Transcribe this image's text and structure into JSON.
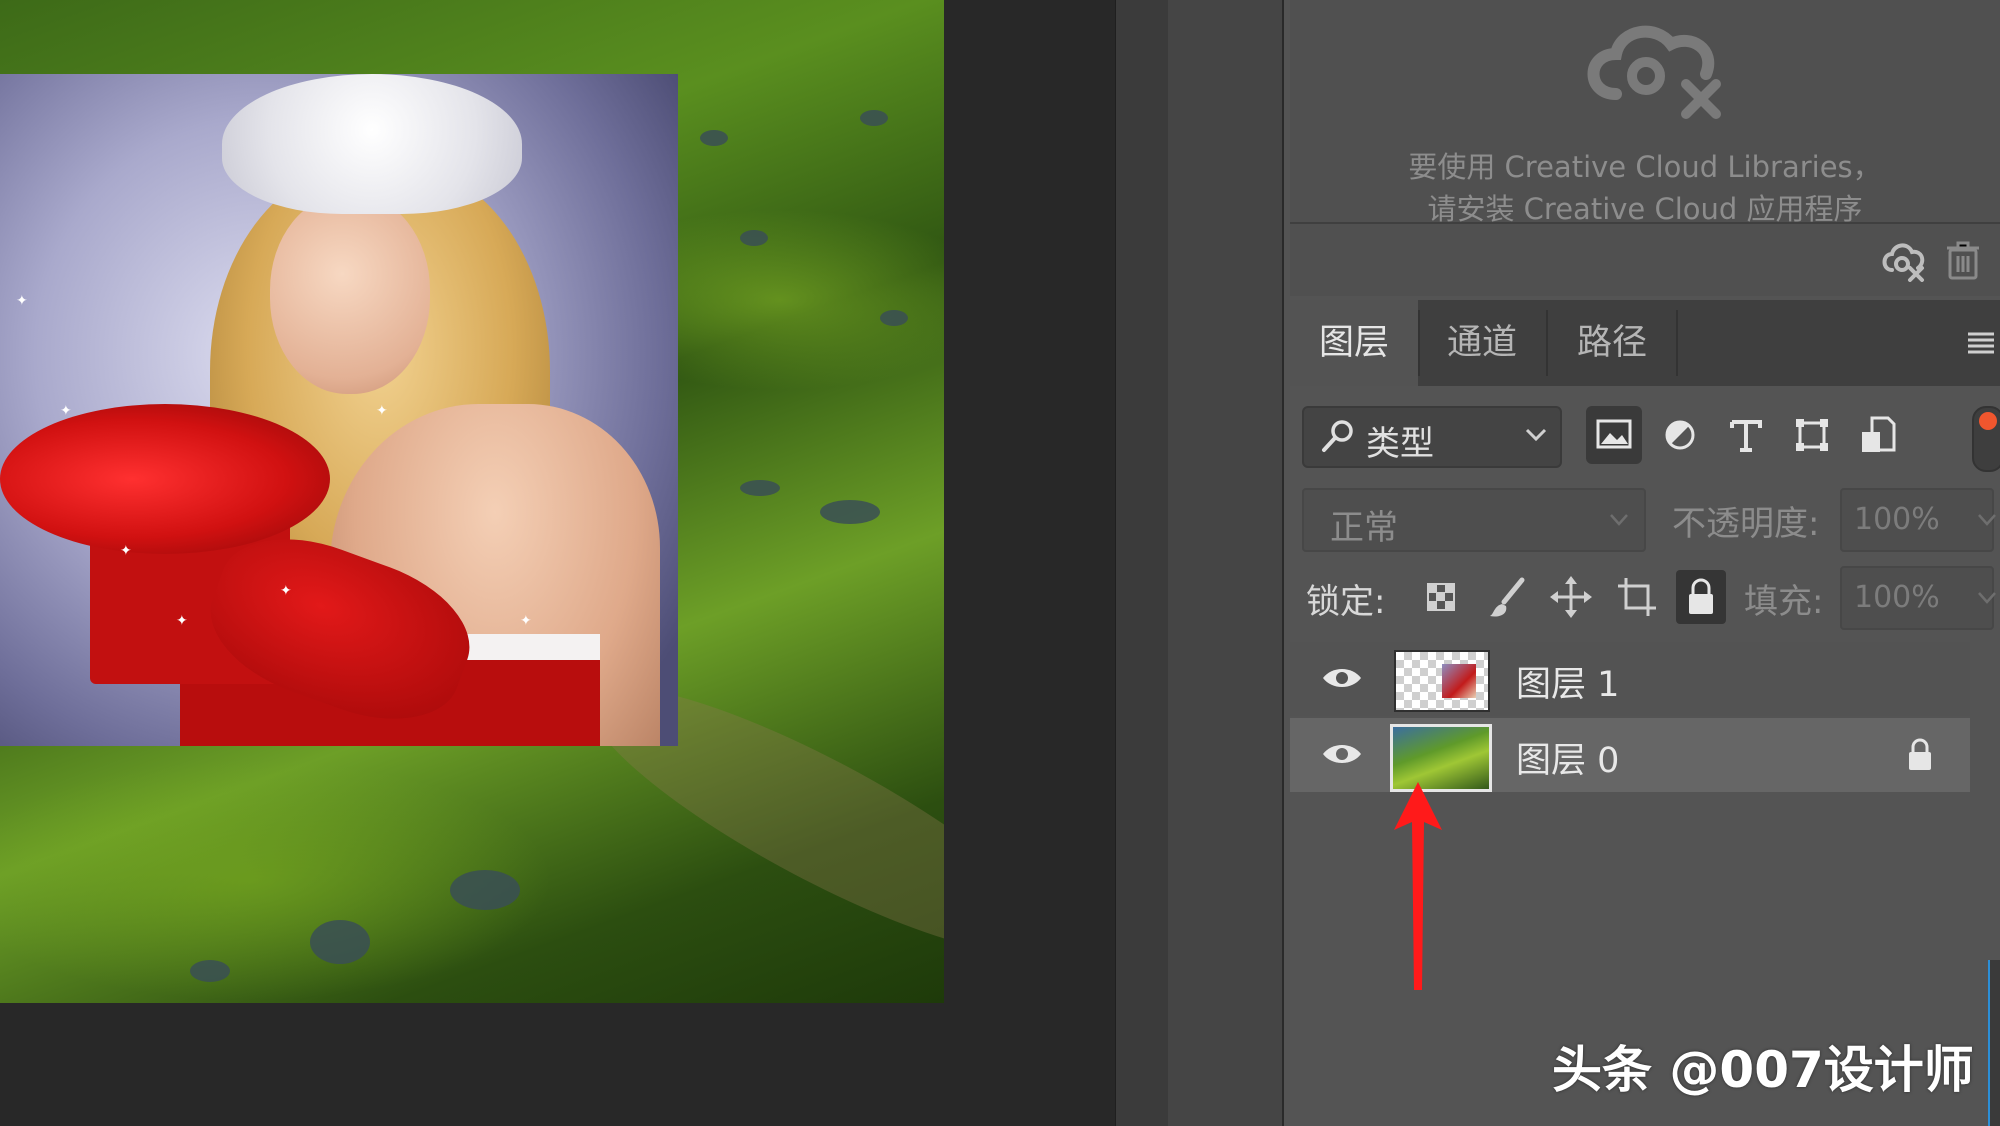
{
  "libraries": {
    "message_line1": "要使用 Creative Cloud Libraries，",
    "message_line2": "请安装 Creative Cloud 应用程序"
  },
  "tabs": [
    {
      "label": "图层",
      "active": true
    },
    {
      "label": "通道",
      "active": false
    },
    {
      "label": "路径",
      "active": false
    }
  ],
  "filter": {
    "kind_label": "类型",
    "buttons": [
      "pixel-layer-filter",
      "adjustment-layer-filter",
      "type-layer-filter",
      "shape-layer-filter",
      "smart-object-filter"
    ]
  },
  "blend": {
    "mode": "正常",
    "opacity_label": "不透明度:",
    "opacity_value": "100%"
  },
  "lock": {
    "label": "锁定:",
    "fill_label": "填充:",
    "fill_value": "100%"
  },
  "layers": [
    {
      "name": "图层 1",
      "visible": true,
      "locked": false,
      "selected": false
    },
    {
      "name": "图层 0",
      "visible": true,
      "locked": true,
      "selected": true
    }
  ],
  "watermark": "头条 @007设计师",
  "colors": {
    "panel_bg": "#545454",
    "selected_layer": "#666666",
    "annotation_arrow": "#ff1a1a",
    "filter_toggle_dot": "#f0562e"
  }
}
